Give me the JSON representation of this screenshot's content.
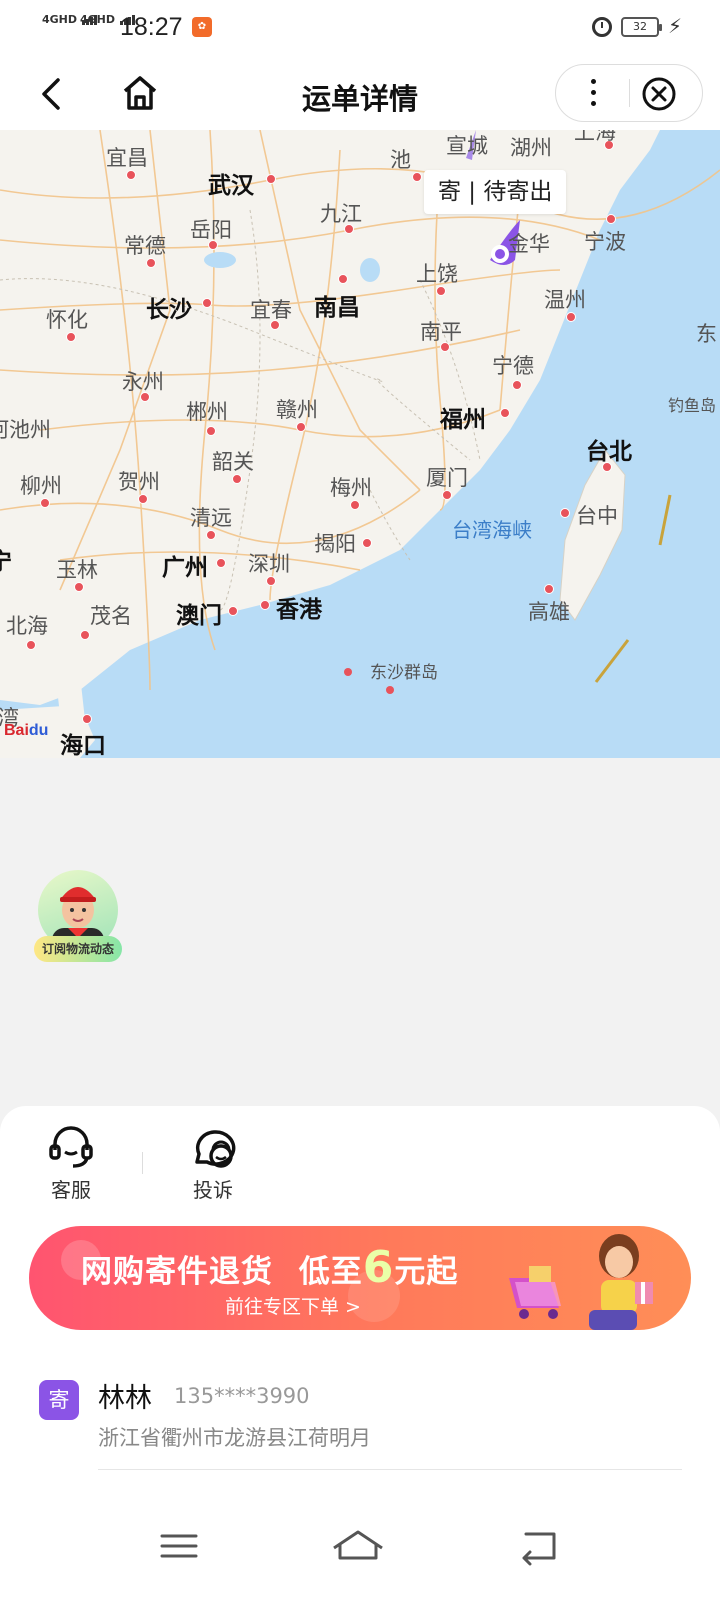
{
  "status_bar": {
    "signal1": "4GHD",
    "signal2": "4GHD",
    "time": "18:27",
    "battery": "32",
    "icons": [
      "signal-icon",
      "app-notification-icon",
      "alarm-icon",
      "battery-icon",
      "charging-icon"
    ]
  },
  "navbar": {
    "title": "运单详情",
    "icons": [
      "back-icon",
      "home-icon",
      "more-icon",
      "close-icon"
    ]
  },
  "map": {
    "status_label": "寄 | 待寄出",
    "logo": "Baidu",
    "cities": [
      {
        "name": "宜昌",
        "style": "normal"
      },
      {
        "name": "武汉",
        "style": "major"
      },
      {
        "name": "池",
        "style": "normal"
      },
      {
        "name": "宣城",
        "style": "normal"
      },
      {
        "name": "湖州",
        "style": "normal"
      },
      {
        "name": "上海",
        "style": "normal"
      },
      {
        "name": "岳阳",
        "style": "normal"
      },
      {
        "name": "九江",
        "style": "normal"
      },
      {
        "name": "常德",
        "style": "normal"
      },
      {
        "name": "金华",
        "style": "normal"
      },
      {
        "name": "宁波",
        "style": "normal"
      },
      {
        "name": "上饶",
        "style": "normal"
      },
      {
        "name": "长沙",
        "style": "major"
      },
      {
        "name": "宜春",
        "style": "normal"
      },
      {
        "name": "南昌",
        "style": "major"
      },
      {
        "name": "温州",
        "style": "normal"
      },
      {
        "name": "怀化",
        "style": "normal"
      },
      {
        "name": "南平",
        "style": "normal"
      },
      {
        "name": "东",
        "style": "normal"
      },
      {
        "name": "永州",
        "style": "normal"
      },
      {
        "name": "宁德",
        "style": "normal"
      },
      {
        "name": "钓鱼岛",
        "style": "normal"
      },
      {
        "name": "郴州",
        "style": "normal"
      },
      {
        "name": "赣州",
        "style": "normal"
      },
      {
        "name": "福州",
        "style": "major"
      },
      {
        "name": "河池州",
        "style": "normal"
      },
      {
        "name": "台北",
        "style": "major"
      },
      {
        "name": "韶关",
        "style": "normal"
      },
      {
        "name": "柳州",
        "style": "normal"
      },
      {
        "name": "贺州",
        "style": "normal"
      },
      {
        "name": "梅州",
        "style": "normal"
      },
      {
        "name": "厦门",
        "style": "normal"
      },
      {
        "name": "清远",
        "style": "normal"
      },
      {
        "name": "台湾海峡",
        "style": "sea"
      },
      {
        "name": "台中",
        "style": "normal"
      },
      {
        "name": "南宁",
        "style": "major"
      },
      {
        "name": "揭阳",
        "style": "normal"
      },
      {
        "name": "玉林",
        "style": "normal"
      },
      {
        "name": "广州",
        "style": "major"
      },
      {
        "name": "深圳",
        "style": "normal"
      },
      {
        "name": "高雄",
        "style": "normal"
      },
      {
        "name": "澳门",
        "style": "major"
      },
      {
        "name": "香港",
        "style": "major"
      },
      {
        "name": "茂名",
        "style": "normal"
      },
      {
        "name": "北海",
        "style": "normal"
      },
      {
        "name": "东沙群岛",
        "style": "normal"
      },
      {
        "name": "湾",
        "style": "normal"
      },
      {
        "name": "海口",
        "style": "major"
      }
    ]
  },
  "subscribe": {
    "label": "订阅物流动态"
  },
  "quick_actions": [
    {
      "label": "客服",
      "icon": "customer-service-icon"
    },
    {
      "label": "投诉",
      "icon": "complaint-icon"
    }
  ],
  "banner": {
    "title_a": "网购寄件退货",
    "title_b": "低至",
    "title_num": "6",
    "title_c": "元起",
    "subtitle": "前往专区下单 >"
  },
  "sender": {
    "badge": "寄",
    "name": "林林",
    "phone": "135****3990",
    "address": "浙江省衢州市龙游县江荷明月"
  },
  "system_nav": [
    "menu-icon",
    "home-icon",
    "back-icon"
  ]
}
